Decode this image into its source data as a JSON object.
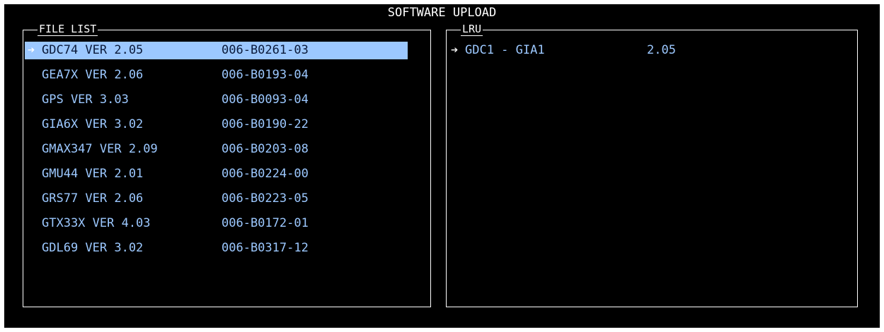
{
  "title": "SOFTWARE UPLOAD",
  "file_list": {
    "label": "FILE LIST",
    "selected_marker": "➔",
    "rows": [
      {
        "name": "GDC74 VER 2.05",
        "part": "006-B0261-03",
        "selected": true
      },
      {
        "name": "GEA7X VER 2.06",
        "part": "006-B0193-04",
        "selected": false
      },
      {
        "name": "GPS VER 3.03",
        "part": "006-B0093-04",
        "selected": false
      },
      {
        "name": "GIA6X VER 3.02",
        "part": "006-B0190-22",
        "selected": false
      },
      {
        "name": "GMAX347 VER 2.09",
        "part": "006-B0203-08",
        "selected": false
      },
      {
        "name": "GMU44 VER 2.01",
        "part": "006-B0224-00",
        "selected": false
      },
      {
        "name": "GRS77 VER 2.06",
        "part": "006-B0223-05",
        "selected": false
      },
      {
        "name": "GTX33X VER 4.03",
        "part": "006-B0172-01",
        "selected": false
      },
      {
        "name": "GDL69 VER 3.02",
        "part": "006-B0317-12",
        "selected": false
      }
    ]
  },
  "lru": {
    "label": "LRU",
    "selected_marker": "➔",
    "rows": [
      {
        "name": "GDC1 - GIA1",
        "version": "2.05",
        "selected": true
      }
    ]
  },
  "colors": {
    "background": "#000000",
    "text_cyan": "#9cc8ff",
    "highlight": "#9cc8ff",
    "border": "#ffffff"
  }
}
